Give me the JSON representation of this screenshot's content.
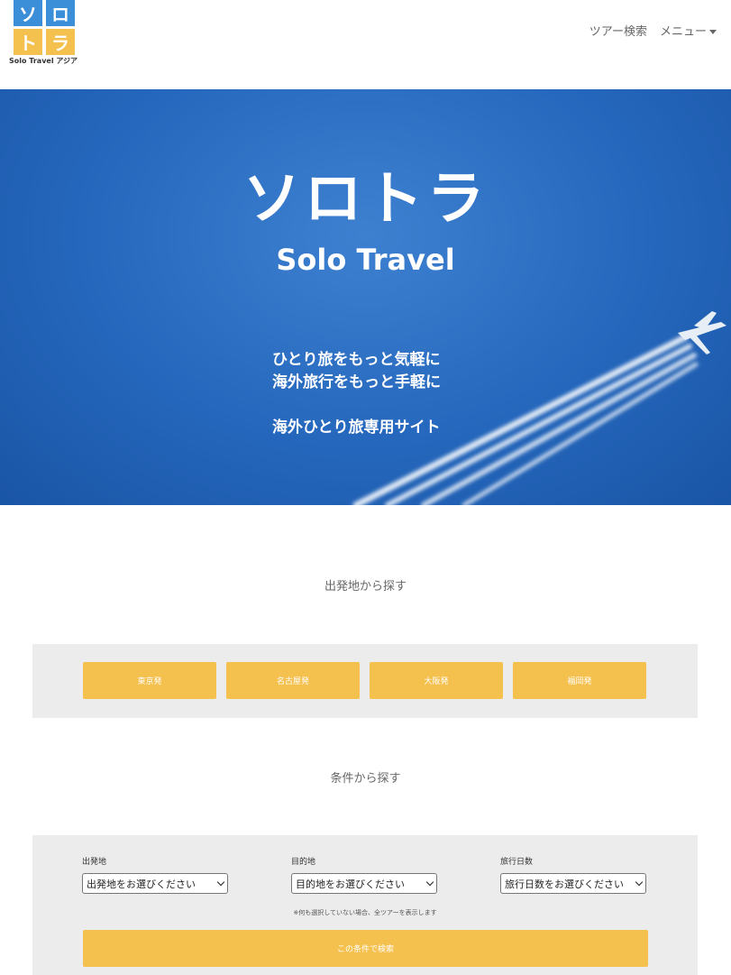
{
  "header": {
    "logo": {
      "cells": [
        "ソ",
        "ロ",
        "ト",
        "ラ"
      ],
      "subtitle": "Solo Travel アジア",
      "colors": {
        "blue": "#3b8fd8",
        "yellow": "#f4c04e"
      }
    },
    "nav": {
      "tour_search": "ツアー検索",
      "menu": "メニュー"
    }
  },
  "hero": {
    "title_jp": "ソロトラ",
    "title_en": "Solo Travel",
    "tagline_1": "ひとり旅をもっと気軽に",
    "tagline_2": "海外旅行をもっと手軽に",
    "tagline_3": "海外ひとり旅専用サイト"
  },
  "departure": {
    "title": "出発地から探す",
    "buttons": [
      "東京発",
      "名古屋発",
      "大阪発",
      "福岡発"
    ]
  },
  "conditions": {
    "title": "条件から探す",
    "fields": [
      {
        "label": "出発地",
        "selected": "出発地をお選びください"
      },
      {
        "label": "目的地",
        "selected": "目的地をお選びください"
      },
      {
        "label": "旅行日数",
        "selected": "旅行日数をお選びください"
      }
    ],
    "note": "※何も選択していない場合、全ツアーを表示します",
    "search_button": "この条件で検索"
  },
  "colors": {
    "accent": "#f4c04e",
    "panel_bg": "#ececec",
    "hero_blue": "#2567bc"
  }
}
